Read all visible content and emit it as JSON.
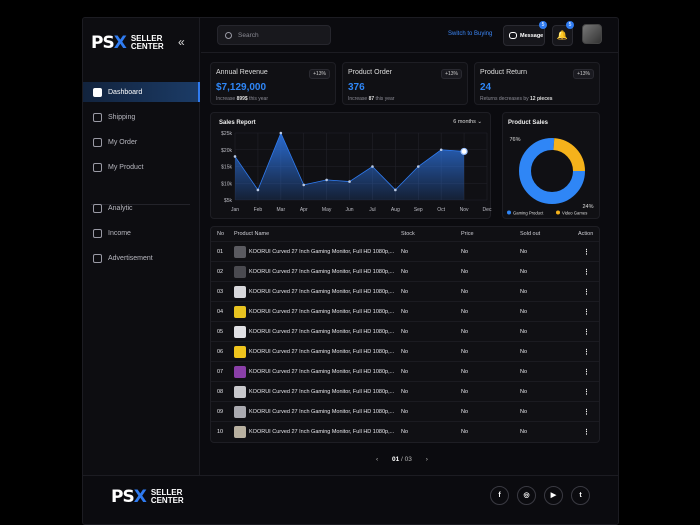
{
  "brand": {
    "mark_a": "PS",
    "mark_b": "X",
    "line1": "SELLER",
    "line2": "CENTER"
  },
  "header": {
    "search_placeholder": "Search",
    "switch_label": "Switch to Buying",
    "message_label": "Message",
    "message_count": "5",
    "notif_count": "5"
  },
  "sidebar": {
    "items": [
      {
        "label": "Dashboard",
        "icon": "grid-icon",
        "active": true
      },
      {
        "label": "Shipping",
        "icon": "truck-icon"
      },
      {
        "label": "My Order",
        "icon": "clipboard-icon"
      },
      {
        "label": "My Product",
        "icon": "box-icon"
      }
    ],
    "items2": [
      {
        "label": "Analytic",
        "icon": "chart-icon"
      },
      {
        "label": "Income",
        "icon": "coin-icon"
      },
      {
        "label": "Advertisement",
        "icon": "megaphone-icon"
      }
    ]
  },
  "stats": [
    {
      "title": "Annual Revenue",
      "value": "$7,129,000",
      "pill": "+13%",
      "sub_pre": "Increase ",
      "sub_bold": "899$",
      "sub_post": " this year"
    },
    {
      "title": "Product Order",
      "value": "376",
      "pill": "+13%",
      "sub_pre": "Increase ",
      "sub_bold": "87",
      "sub_post": " this year"
    },
    {
      "title": "Product Return",
      "value": "24",
      "pill": "+13%",
      "sub_pre": "Returns decreases by ",
      "sub_bold": "12 pieces",
      "sub_post": ""
    }
  ],
  "sales_report": {
    "title": "Sales Report",
    "period": "6 months"
  },
  "product_sales": {
    "title": "Product Sales",
    "pct_a": "76%",
    "pct_b": "24%",
    "legend_a": "Gaming Product",
    "legend_b": "Video Games"
  },
  "chart_data": [
    {
      "type": "area",
      "title": "Sales Report",
      "categories": [
        "Jan",
        "Feb",
        "Mar",
        "Apr",
        "May",
        "Jun",
        "Jul",
        "Aug",
        "Sep",
        "Oct",
        "Nov",
        "Dec"
      ],
      "y_ticks": [
        "$5k",
        "$10k",
        "$15k",
        "$20k",
        "$25k"
      ],
      "ylim": [
        5,
        25
      ],
      "values": [
        18,
        8,
        25,
        9.5,
        11,
        10.5,
        15,
        8,
        15,
        20,
        19.5,
        null
      ],
      "highlight_index": 10,
      "color": "#2f7bf0",
      "grid": true
    },
    {
      "type": "pie",
      "title": "Product Sales",
      "labels": [
        "Gaming Product",
        "Video Games"
      ],
      "values": [
        76,
        24
      ],
      "colors": [
        "#2f86f6",
        "#f5b21b"
      ]
    }
  ],
  "table": {
    "headers": {
      "no": "No",
      "name": "Product Name",
      "stock": "Stock",
      "price": "Price",
      "sold": "Sold out",
      "action": "Action"
    },
    "rows": [
      {
        "no": "01",
        "name": "KOORUI Curved 27 Inch Gaming Monitor, Full HD 1080p,...",
        "stock": "No",
        "price": "No",
        "sold": "No",
        "thumb": "#5a5a60"
      },
      {
        "no": "02",
        "name": "KOORUI Curved 27 Inch Gaming Monitor, Full HD 1080p,...",
        "stock": "No",
        "price": "No",
        "sold": "No",
        "thumb": "#4a4a50"
      },
      {
        "no": "03",
        "name": "KOORUI Curved 27 Inch Gaming Monitor, Full HD 1080p,...",
        "stock": "No",
        "price": "No",
        "sold": "No",
        "thumb": "#d8d8dc"
      },
      {
        "no": "04",
        "name": "KOORUI Curved 27 Inch Gaming Monitor, Full HD 1080p,...",
        "stock": "No",
        "price": "No",
        "sold": "No",
        "thumb": "#e8c320"
      },
      {
        "no": "05",
        "name": "KOORUI Curved 27 Inch Gaming Monitor, Full HD 1080p,...",
        "stock": "No",
        "price": "No",
        "sold": "No",
        "thumb": "#e0e0e4"
      },
      {
        "no": "06",
        "name": "KOORUI Curved 27 Inch Gaming Monitor, Full HD 1080p,...",
        "stock": "No",
        "price": "No",
        "sold": "No",
        "thumb": "#efc41d"
      },
      {
        "no": "07",
        "name": "KOORUI Curved 27 Inch Gaming Monitor, Full HD 1080p,...",
        "stock": "No",
        "price": "No",
        "sold": "No",
        "thumb": "#8a3fa8"
      },
      {
        "no": "08",
        "name": "KOORUI Curved 27 Inch Gaming Monitor, Full HD 1080p,...",
        "stock": "No",
        "price": "No",
        "sold": "No",
        "thumb": "#c8c8cc"
      },
      {
        "no": "09",
        "name": "KOORUI Curved 27 Inch Gaming Monitor, Full HD 1080p,...",
        "stock": "No",
        "price": "No",
        "sold": "No",
        "thumb": "#aaaab0"
      },
      {
        "no": "10",
        "name": "KOORUI Curved 27 Inch Gaming Monitor, Full HD 1080p,...",
        "stock": "No",
        "price": "No",
        "sold": "No",
        "thumb": "#b8b0a0"
      }
    ]
  },
  "pagination": {
    "current": "01",
    "total": "/ 03"
  },
  "footer": {
    "social": [
      {
        "icon": "facebook-icon",
        "glyph": "f"
      },
      {
        "icon": "instagram-icon",
        "glyph": "◎"
      },
      {
        "icon": "youtube-icon",
        "glyph": "▶"
      },
      {
        "icon": "twitter-icon",
        "glyph": "t"
      }
    ]
  },
  "colors": {
    "accent": "#2f7bf0",
    "gold": "#f5b21b",
    "bg": "#0b0b0f"
  }
}
